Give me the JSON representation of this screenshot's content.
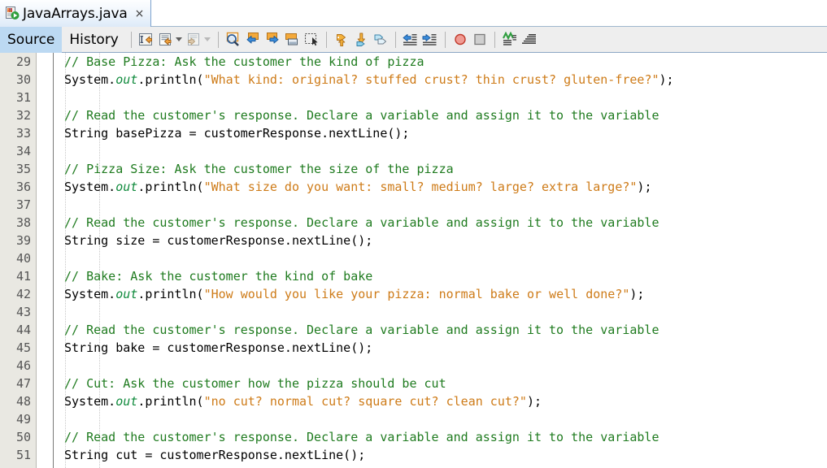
{
  "window": {
    "tab": {
      "title": "JavaArrays.java",
      "icon": "java-file-icon",
      "close_label": "×"
    }
  },
  "toolbar": {
    "view_tabs": [
      {
        "label": "Source",
        "selected": true
      },
      {
        "label": "History",
        "selected": false
      }
    ],
    "buttons": [
      {
        "name": "last-edit-icon",
        "group": 1
      },
      {
        "name": "back-history-icon",
        "group": 1,
        "caret": true
      },
      {
        "name": "forward-history-icon",
        "group": 1,
        "caret": true,
        "disabled": true
      },
      {
        "name": "find-selection-icon",
        "group": 2
      },
      {
        "name": "previous-bookmark-icon",
        "group": 2
      },
      {
        "name": "next-bookmark-icon",
        "group": 2
      },
      {
        "name": "toggle-bookmark-icon",
        "group": 2
      },
      {
        "name": "rectangular-selection-icon",
        "group": 2
      },
      {
        "name": "previous-error-icon",
        "group": 3
      },
      {
        "name": "next-error-icon",
        "group": 3
      },
      {
        "name": "toggle-highlight-icon",
        "group": 3
      },
      {
        "name": "shift-left-icon",
        "group": 4
      },
      {
        "name": "shift-right-icon",
        "group": 4
      },
      {
        "name": "toggle-breakpoint-icon",
        "group": 5
      },
      {
        "name": "stop-icon",
        "group": 5
      },
      {
        "name": "toggle-rectangular-icon",
        "group": 6
      },
      {
        "name": "format-icon",
        "group": 6
      }
    ]
  },
  "editor": {
    "first_line": 29,
    "lines": [
      {
        "num": 29,
        "tokens": [
          {
            "t": "cmt",
            "v": "// Base Pizza: Ask the customer the kind of pizza"
          }
        ]
      },
      {
        "num": 30,
        "tokens": [
          {
            "t": "pln",
            "v": "System."
          },
          {
            "t": "fld",
            "v": "out"
          },
          {
            "t": "pln",
            "v": ".println("
          },
          {
            "t": "str",
            "v": "\"What kind: original? stuffed crust? thin crust? gluten-free?\""
          },
          {
            "t": "pln",
            "v": ");"
          }
        ]
      },
      {
        "num": 31,
        "tokens": []
      },
      {
        "num": 32,
        "tokens": [
          {
            "t": "cmt",
            "v": "// Read the customer's response. Declare a variable and assign it to the variable"
          }
        ]
      },
      {
        "num": 33,
        "tokens": [
          {
            "t": "pln",
            "v": "String basePizza = customerResponse.nextLine();"
          }
        ]
      },
      {
        "num": 34,
        "tokens": []
      },
      {
        "num": 35,
        "tokens": [
          {
            "t": "cmt",
            "v": "// Pizza Size: Ask the customer the size of the pizza"
          }
        ]
      },
      {
        "num": 36,
        "tokens": [
          {
            "t": "pln",
            "v": "System."
          },
          {
            "t": "fld",
            "v": "out"
          },
          {
            "t": "pln",
            "v": ".println("
          },
          {
            "t": "str",
            "v": "\"What size do you want: small? medium? large? extra large?\""
          },
          {
            "t": "pln",
            "v": ");"
          }
        ]
      },
      {
        "num": 37,
        "tokens": []
      },
      {
        "num": 38,
        "tokens": [
          {
            "t": "cmt",
            "v": "// Read the customer's response. Declare a variable and assign it to the variable"
          }
        ]
      },
      {
        "num": 39,
        "tokens": [
          {
            "t": "pln",
            "v": "String size = customerResponse.nextLine();"
          }
        ]
      },
      {
        "num": 40,
        "tokens": []
      },
      {
        "num": 41,
        "tokens": [
          {
            "t": "cmt",
            "v": "// Bake: Ask the customer the kind of bake"
          }
        ]
      },
      {
        "num": 42,
        "tokens": [
          {
            "t": "pln",
            "v": "System."
          },
          {
            "t": "fld",
            "v": "out"
          },
          {
            "t": "pln",
            "v": ".println("
          },
          {
            "t": "str",
            "v": "\"How would you like your pizza: normal bake or well done?\""
          },
          {
            "t": "pln",
            "v": ");"
          }
        ]
      },
      {
        "num": 43,
        "tokens": []
      },
      {
        "num": 44,
        "tokens": [
          {
            "t": "cmt",
            "v": "// Read the customer's response. Declare a variable and assign it to the variable"
          }
        ]
      },
      {
        "num": 45,
        "tokens": [
          {
            "t": "pln",
            "v": "String bake = customerResponse.nextLine();"
          }
        ]
      },
      {
        "num": 46,
        "tokens": []
      },
      {
        "num": 47,
        "tokens": [
          {
            "t": "cmt",
            "v": "// Cut: Ask the customer how the pizza should be cut"
          }
        ]
      },
      {
        "num": 48,
        "tokens": [
          {
            "t": "pln",
            "v": "System."
          },
          {
            "t": "fld",
            "v": "out"
          },
          {
            "t": "pln",
            "v": ".println("
          },
          {
            "t": "str",
            "v": "\"no cut? normal cut? square cut? clean cut?\""
          },
          {
            "t": "pln",
            "v": ");"
          }
        ]
      },
      {
        "num": 49,
        "tokens": []
      },
      {
        "num": 50,
        "tokens": [
          {
            "t": "cmt",
            "v": "// Read the customer's response. Declare a variable and assign it to the variable"
          }
        ]
      },
      {
        "num": 51,
        "tokens": [
          {
            "t": "pln",
            "v": "String cut = customerResponse.nextLine();"
          }
        ]
      }
    ],
    "indent_guides_x": [
      80,
      122
    ]
  },
  "colors": {
    "comment": "#1f7b1f",
    "string": "#ce7b18",
    "field": "#0f8a3c",
    "plain": "#000000",
    "gutter_bg": "#e9e8e2",
    "tab_selected_bg": "#bcd9f2",
    "toolbar_bg": "#eeeeee"
  }
}
